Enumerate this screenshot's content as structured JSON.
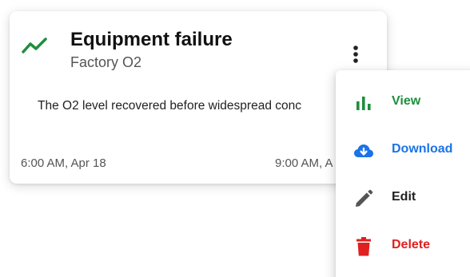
{
  "card": {
    "title": "Equipment failure",
    "subtitle": "Factory O2",
    "body": "The O2 level recovered before widespread conc",
    "time_start": "6:00 AM, Apr 18",
    "time_end": "9:00 AM, A",
    "icon": "trending-line-icon",
    "icon_color": "#1e8e3e"
  },
  "menu": {
    "items": [
      {
        "label": "View",
        "icon": "bar-chart-icon",
        "color": "#1e8e3e"
      },
      {
        "label": "Download",
        "icon": "cloud-download-icon",
        "color": "#1a73e8"
      },
      {
        "label": "Edit",
        "icon": "pencil-icon",
        "color": "#222222"
      },
      {
        "label": "Delete",
        "icon": "trash-icon",
        "color": "#e02020"
      }
    ]
  }
}
